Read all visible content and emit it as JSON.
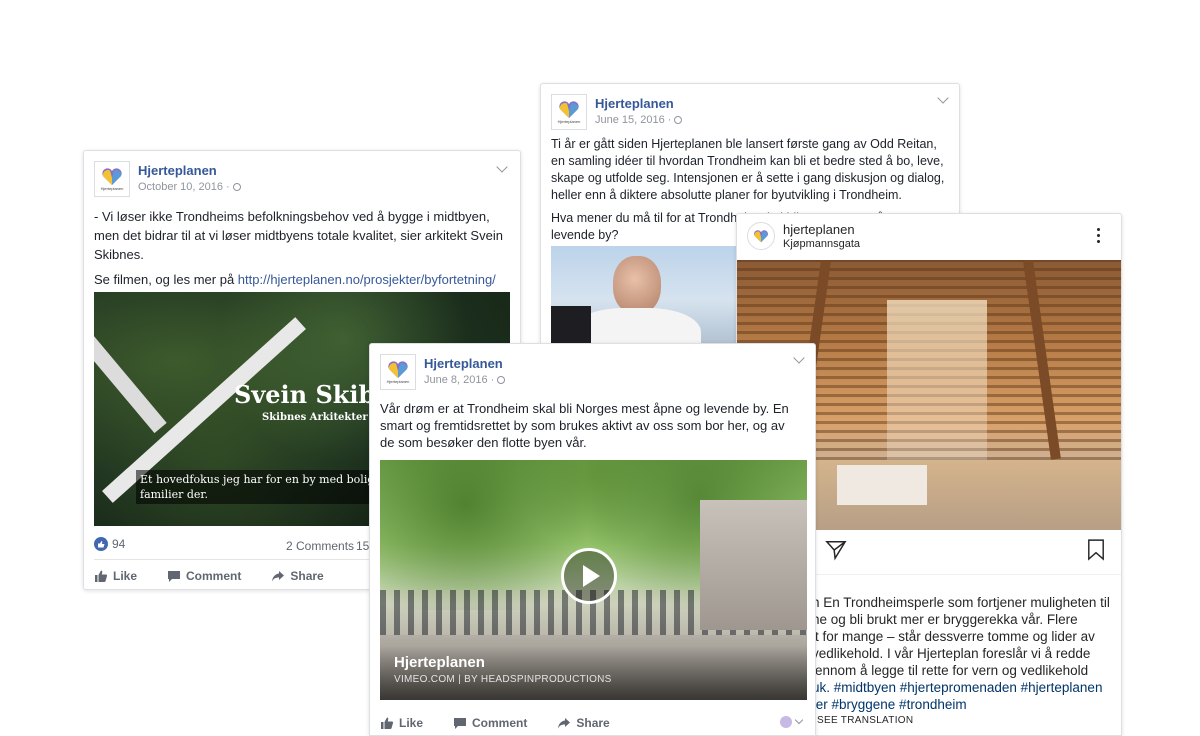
{
  "post1": {
    "name": "Hjerteplanen",
    "date": "October 10, 2016 ·",
    "text1": "- Vi løser ikke Trondheims befolkningsbehov ved å bygge i midtbyen, men det bidrar til at vi løser midtbyens totale kvalitet, sier arkitekt Svein Skibnes.",
    "text2_prefix": "Se filmen, og les mer på ",
    "text2_link": "http://hjerteplanen.no/prosjekter/byfortetning/",
    "video_title": "Svein Skibnes",
    "video_subtitle": "Skibnes Arkitekter AS",
    "video_caption1": "Et hovedfokus jeg har for en by med bolig er at de",
    "video_caption2": "familier der.",
    "likes": "94",
    "comments": "2 Comments",
    "shares_partial": "15",
    "like_label": "Like",
    "comment_label": "Comment",
    "share_label": "Share"
  },
  "post2": {
    "name": "Hjerteplanen",
    "date": "June 15, 2016 ·",
    "text1": "Ti år er gått siden Hjerteplanen ble lansert første gang av Odd Reitan, en samling idéer til hvordan Trondheim kan bli et bedre sted å bo, leve, skape og utfolde seg. Intensjonen er å sette i gang diskusjon og dialog, heller enn å diktere absolutte planer for byutvikling i Trondheim.",
    "text2": "Hva mener du må til for at Trondheim skal bli Norges mest åpne og levende by?"
  },
  "post3": {
    "name": "Hjerteplanen",
    "date": "June 8, 2016 ·",
    "text": "Vår drøm er at Trondheim skal bli Norges mest åpne og levende by. En smart og fremtidsrettet by som brukes aktivt av oss som bor her, og av de som besøker den flotte byen vår.",
    "video_title": "Hjerteplanen",
    "video_source": "VIMEO.COM | BY HEADSPINPRODUCTIONS",
    "like_label": "Like",
    "comment_label": "Comment",
    "share_label": "Share"
  },
  "instagram": {
    "username": "hjerteplanen",
    "location": "Kjøpmannsgata",
    "caption_lines": [
      "n En Trondheimsperle som fortjener muligheten til",
      "ne og bli brukt mer er bryggerekka vår. Flere",
      "lt for mange – står dessverre tomme og lider av",
      "vedlikehold. I vår Hjerteplan foreslår vi å redde",
      "jennom å legge til rette for vern og vedlikehold",
      "uk. #midtbyen #hjertepromenaden #hjerteplanen",
      "ter #bryggene #trondheim"
    ],
    "see_translation": "SEE TRANSLATION"
  },
  "colors": {
    "fb_blue": "#365899",
    "like_blue": "#4267b2",
    "ig_text": "#262626"
  },
  "icons": [
    "heart-logo-icon",
    "globe-icon",
    "chevron-down-icon",
    "like-icon",
    "comment-icon",
    "share-icon",
    "play-icon",
    "more-icon",
    "send-icon",
    "bookmark-icon"
  ]
}
